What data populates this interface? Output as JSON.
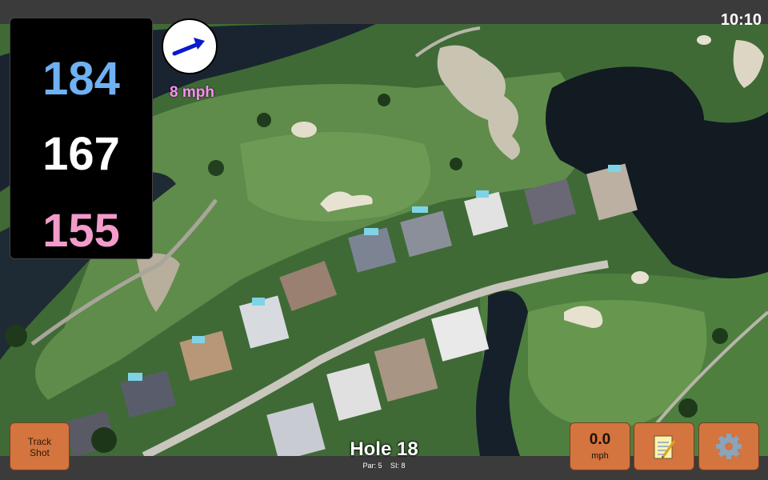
{
  "status": {
    "time": "10:10"
  },
  "distances": {
    "back": "184",
    "middle": "167",
    "front": "155"
  },
  "wind": {
    "speed_label": "8 mph",
    "direction_icon": "wind-arrow-icon"
  },
  "buttons": {
    "track_shot_line1": "Track",
    "track_shot_line2": "Shot",
    "speed_value": "0.0",
    "speed_unit": "mph",
    "notes_icon": "notepad-icon",
    "settings_icon": "gear-icon"
  },
  "hole": {
    "title": "Hole 18",
    "par": "Par: 5",
    "si": "SI: 8"
  },
  "colors": {
    "back_distance": "#6fb1f2",
    "middle_distance": "#ffffff",
    "front_distance": "#f39bcb",
    "button": "#d4743e",
    "wind_text": "#ff8ef7"
  }
}
